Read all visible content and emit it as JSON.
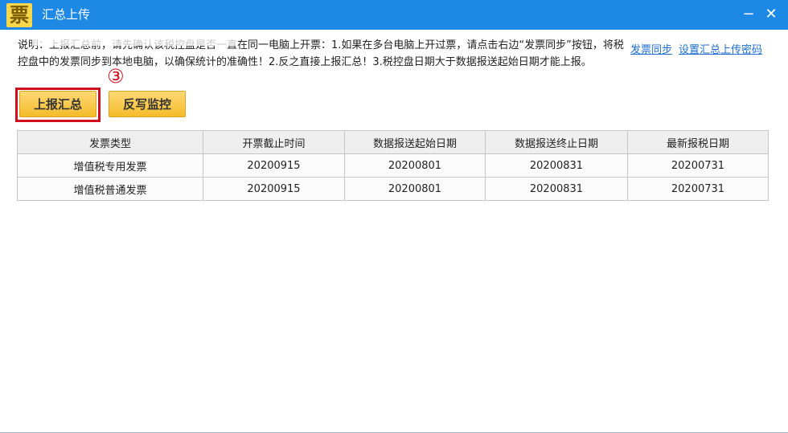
{
  "window": {
    "title": "汇总上传",
    "app_icon_glyph": "票",
    "minimize_glyph": "−",
    "close_glyph": "✕"
  },
  "notice": {
    "text": "说明：上报汇总前，请先确认该税控盘是否一直在同一电脑上开票：1.如果在多台电脑上开过票，请点击右边“发票同步”按钮，将税控盘中的发票同步到本地电脑，以确保统计的准确性！2.反之直接上报汇总！3.税控盘日期大于数据报送起始日期才能上报。"
  },
  "links": {
    "invoice_sync": "发票同步",
    "set_upload_password": "设置汇总上传密码"
  },
  "annotation": {
    "step_marker": "③"
  },
  "buttons": {
    "upload_summary": "上报汇总",
    "write_back_monitor": "反写监控"
  },
  "table": {
    "headers": [
      "发票类型",
      "开票截止时间",
      "数据报送起始日期",
      "数据报送终止日期",
      "最新报税日期"
    ],
    "rows": [
      [
        "增值税专用发票",
        "20200915",
        "20200801",
        "20200831",
        "20200731"
      ],
      [
        "增值税普通发票",
        "20200915",
        "20200801",
        "20200831",
        "20200731"
      ]
    ]
  },
  "colors": {
    "titlebar": "#1e88e5",
    "button_yellow": "#f4bc2b",
    "highlight_red": "#d10f1c",
    "link_blue": "#1c6fd0"
  }
}
